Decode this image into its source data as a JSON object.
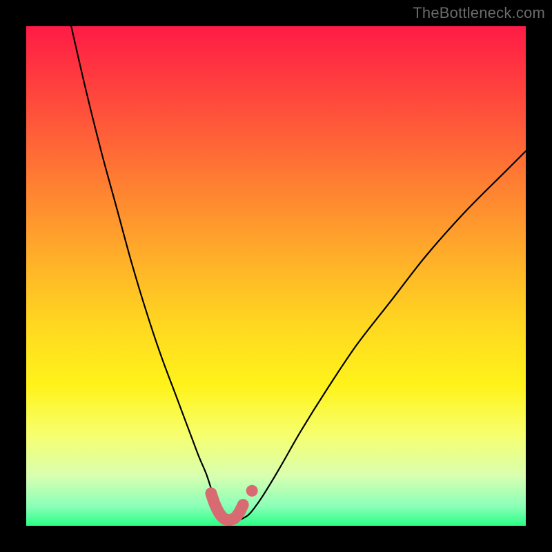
{
  "watermark": "TheBottleneck.com",
  "chart_data": {
    "type": "line",
    "title": "",
    "xlabel": "",
    "ylabel": "",
    "xlim": [
      0,
      100
    ],
    "ylim": [
      0,
      100
    ],
    "grid": false,
    "series": [
      {
        "name": "black-curve",
        "x": [
          9,
          12,
          15,
          18,
          21,
          24,
          27,
          30,
          33,
          34.5,
          36,
          37,
          38,
          38.5,
          39,
          39.5,
          40,
          41,
          42,
          43,
          44.5,
          46,
          48,
          51,
          55,
          60,
          66,
          73,
          80,
          88,
          96,
          100
        ],
        "y": [
          100,
          87,
          75,
          64,
          53,
          43,
          34,
          26,
          18,
          14,
          10.5,
          7.5,
          5,
          3.7,
          2.6,
          1.8,
          1.2,
          1.0,
          1.0,
          1.3,
          2.2,
          4.0,
          7,
          12,
          19,
          27,
          36,
          45,
          54,
          63,
          71,
          75
        ]
      },
      {
        "name": "pink-trough",
        "x": [
          37.0,
          37.8,
          38.6,
          39.4,
          40.2,
          41.0,
          41.8,
          42.6,
          43.4
        ],
        "y": [
          6.5,
          4.2,
          2.6,
          1.6,
          1.2,
          1.2,
          1.6,
          2.6,
          4.2
        ]
      },
      {
        "name": "pink-dot",
        "x": [
          45.2
        ],
        "y": [
          7.0
        ]
      }
    ],
    "background_gradient": {
      "stops": [
        {
          "pos": 0.0,
          "color": "#ff1b46"
        },
        {
          "pos": 0.1,
          "color": "#ff3a3f"
        },
        {
          "pos": 0.22,
          "color": "#ff6038"
        },
        {
          "pos": 0.35,
          "color": "#ff8a30"
        },
        {
          "pos": 0.48,
          "color": "#ffb428"
        },
        {
          "pos": 0.6,
          "color": "#ffd820"
        },
        {
          "pos": 0.72,
          "color": "#fff31a"
        },
        {
          "pos": 0.82,
          "color": "#f6ff70"
        },
        {
          "pos": 0.9,
          "color": "#d8ffb0"
        },
        {
          "pos": 0.96,
          "color": "#8cffb8"
        },
        {
          "pos": 1.0,
          "color": "#2aff86"
        }
      ]
    }
  }
}
